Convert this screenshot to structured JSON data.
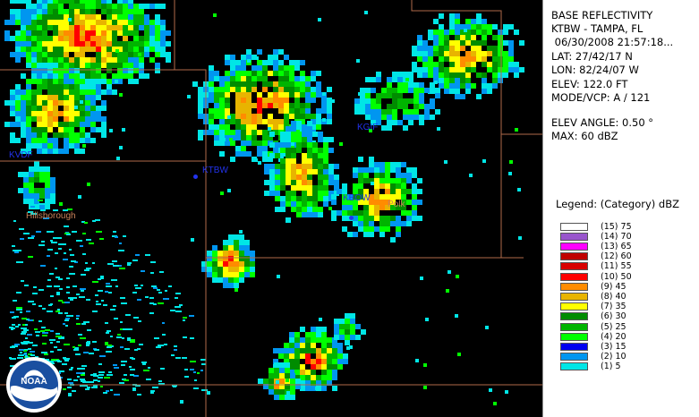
{
  "info": {
    "product": "BASE REFLECTIVITY",
    "station": "KTBW - TAMPA, FL",
    "datetime": " 06/30/2008 21:57:18...",
    "lat": "LAT: 27/42/17 N",
    "lon": "LON: 82/24/07 W",
    "elev": "ELEV: 122.0 FT",
    "mode": "MODE/VCP: A / 121",
    "elev_angle": "ELEV ANGLE: 0.50 °",
    "max": "MAX: 60 dBZ"
  },
  "legend": {
    "title": "Legend: (Category) dBZ",
    "items": [
      {
        "label": "(15) 75",
        "color": "#ffffff"
      },
      {
        "label": "(14) 70",
        "color": "#9955cc"
      },
      {
        "label": "(13) 65",
        "color": "#ff00ff"
      },
      {
        "label": "(12) 60",
        "color": "#c00000"
      },
      {
        "label": "(11) 55",
        "color": "#d80000"
      },
      {
        "label": "(10) 50",
        "color": "#ff0000"
      },
      {
        "label": "(9) 45",
        "color": "#ff8c00"
      },
      {
        "label": "(8) 40",
        "color": "#e8b400"
      },
      {
        "label": "(7) 35",
        "color": "#ffff00"
      },
      {
        "label": "(6) 30",
        "color": "#008c00"
      },
      {
        "label": "(5) 25",
        "color": "#00b400"
      },
      {
        "label": "(4) 20",
        "color": "#00ff00"
      },
      {
        "label": "(3) 15",
        "color": "#0000f0"
      },
      {
        "label": "(2) 10",
        "color": "#0096f0"
      },
      {
        "label": "(1) 5",
        "color": "#00e6e6"
      }
    ]
  },
  "map": {
    "sites": [
      "KVDF",
      "KTBW",
      "KBOW",
      "KGIF"
    ],
    "counties": [
      "Hillsborough",
      "Polk"
    ],
    "logo_text": "NOAA"
  }
}
